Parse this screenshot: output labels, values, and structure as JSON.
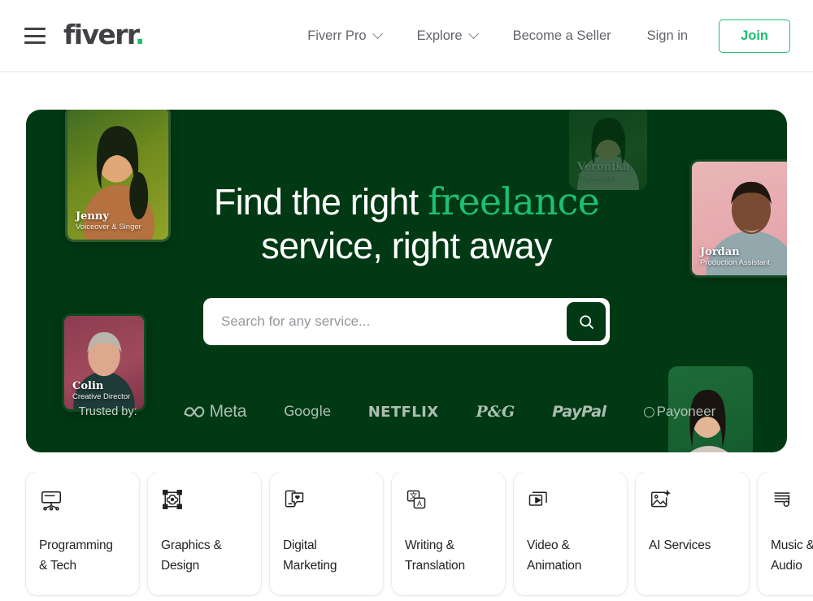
{
  "header": {
    "menu_icon": "hamburger-icon",
    "logo_text": "fiverr",
    "logo_dot": ".",
    "nav": [
      {
        "label": "Fiverr Pro",
        "has_chevron": true
      },
      {
        "label": "Explore",
        "has_chevron": true
      },
      {
        "label": "Become a Seller",
        "has_chevron": false
      },
      {
        "label": "Sign in",
        "has_chevron": false
      }
    ],
    "join_label": "Join"
  },
  "hero": {
    "background_color": "#013914",
    "title_part1": "Find the right ",
    "title_accent": "freelance",
    "title_part2": "service, right away",
    "search": {
      "placeholder": "Search for any service...",
      "value": "",
      "button_icon": "search-icon"
    },
    "trusted": {
      "label": "Trusted by:",
      "brands": [
        "Meta",
        "Google",
        "NETFLIX",
        "P&G",
        "PayPal",
        "Payoneer"
      ]
    },
    "people": [
      {
        "name": "Jenny",
        "role": "Voiceover & Singer"
      },
      {
        "name": "Colin",
        "role": "Creative Director"
      },
      {
        "name": "Veronika",
        "role": "Translation"
      },
      {
        "name": "Jordan",
        "role": "Production Assistant"
      },
      {
        "name": "",
        "role": ""
      }
    ]
  },
  "categories": [
    {
      "label": "Programming\n& Tech",
      "icon": "monitor-code-icon"
    },
    {
      "label": "Graphics &\nDesign",
      "icon": "design-node-icon"
    },
    {
      "label": "Digital\nMarketing",
      "icon": "phone-heart-icon"
    },
    {
      "label": "Writing &\nTranslation",
      "icon": "translate-icon"
    },
    {
      "label": "Video &\nAnimation",
      "icon": "video-play-icon"
    },
    {
      "label": "AI Services",
      "icon": "image-sparkle-icon"
    },
    {
      "label": "Music &\nAudio",
      "icon": "music-wave-icon"
    }
  ],
  "colors": {
    "brand_green": "#1dbf73",
    "hero_green": "#013914",
    "text_dark": "#404145",
    "text_muted": "#62646a"
  }
}
